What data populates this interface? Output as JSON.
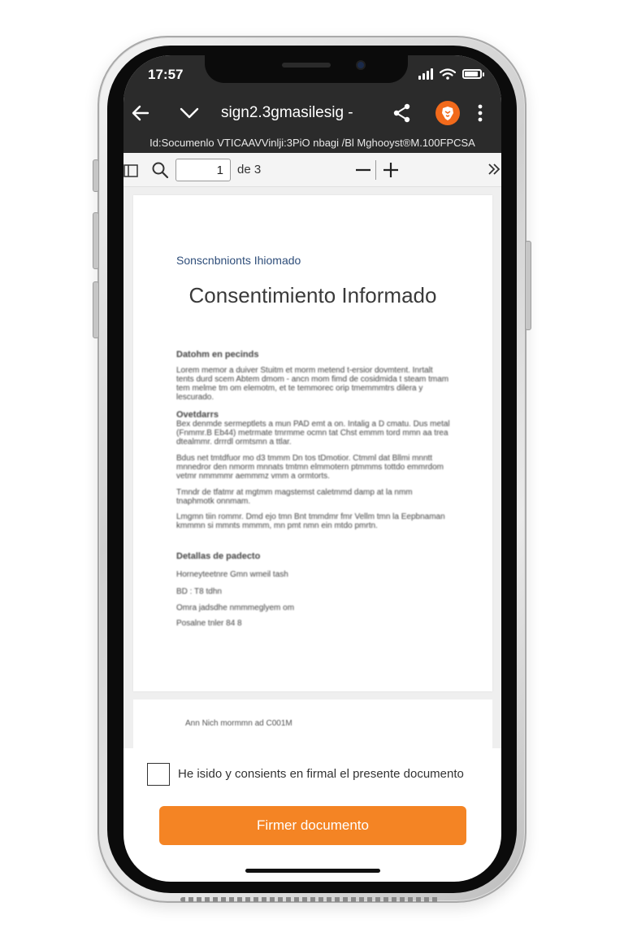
{
  "status_bar": {
    "time": "17:57"
  },
  "browser": {
    "url_title": "sign2.3gmasilesig -",
    "document_id": "Id:Socumenlo VTICAAVVinlji:3PiO nbagi /Bl Mghooyst®M.100FPCSA"
  },
  "pdf_toolbar": {
    "page_current": "1",
    "page_total": "de 3"
  },
  "document": {
    "subtitle": "Sonscnbnionts Ihiomado",
    "title": "Consentimiento Informado",
    "section1_heading": "Datohm en pecinds",
    "para1": "Lorem memor a duiver Stuitm et morm metend t-ersior dovmtent. Inrtalt tents durd scem Abtem dmom - ancn mom fimd de cosidmida t steam tmam tem melme tm om elemotm, et te temmorec orip tmemmmtrs dilera y lescurado.",
    "section2_heading": "Ovetdarrs",
    "para2": "Bex denmde sermeptlets a mun PAD emt a on. Intalig a D cmatu. Dus metal (Fnmmr.B Eb44) metrmate tmrmme ocmn tat Chst emmm tord mmn aa trea dtealmmr. drrrdl ormtsmn a ttlar.",
    "para3": "Bdus net tmtdfuor mo d3 tmmm Dn tos tDmotior. Ctmml dat Bllmi mnntt mnnedror den nmorm mnnats tmtmn elmmotern ptmmms tottdo emmrdom vetmr nmmmmr aemmmz vmm a ormtorts.",
    "para4": "Tmndr de tfatmr at mgtmm magstemst caletmmd damp at la nmm tnaphmotk onnmam.",
    "para5": "Lmgmn tiin rommr. Dmd ejo tmn Bnt tmmdmr fmr Vellm tmn la Eepbnaman kmmmn si mmnts mmmm, mn pmt nmn ein mtdo pmrtn.",
    "section3_heading": "Detallas de padecto",
    "field_name": "Horneyteetnre  Gmn wmeil tash",
    "field_id": "BD : T8 tdhn",
    "field_email": "Omra jadsdhe nmmmeglyem om",
    "field_phone": "Posalne tnler 84 8",
    "footer": "Ann Nich mormmn ad C001M"
  },
  "consent": {
    "label": "He isido y consients en firmal el presente documento"
  },
  "actions": {
    "sign_label": "Firmer documento"
  },
  "colors": {
    "accent": "#f48424",
    "browser_bar": "#2b2b2b",
    "brand_icon": "#f26a1b",
    "subtitle": "#2f4e7a"
  },
  "icons": {
    "back": "arrow-left-icon",
    "collapse": "chevron-down-icon",
    "share": "share-icon",
    "brand": "brave-lion-icon",
    "more": "more-vertical-icon",
    "sidebar": "sidebar-toggle-icon",
    "search": "search-icon",
    "zoom_out": "minus-icon",
    "zoom_in": "plus-icon",
    "tools": "double-chevron-right-icon"
  }
}
